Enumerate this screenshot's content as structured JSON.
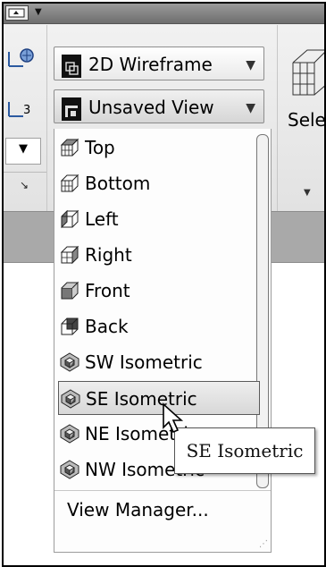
{
  "view_style": {
    "current": "2D Wireframe",
    "icon": "visual-style-icon"
  },
  "view": {
    "current": "Unsaved View",
    "icon": "view-icon",
    "items": [
      {
        "label": "Top",
        "icon": "view-top-icon"
      },
      {
        "label": "Bottom",
        "icon": "view-bottom-icon"
      },
      {
        "label": "Left",
        "icon": "view-left-icon"
      },
      {
        "label": "Right",
        "icon": "view-right-icon"
      },
      {
        "label": "Front",
        "icon": "view-front-icon"
      },
      {
        "label": "Back",
        "icon": "view-back-icon"
      },
      {
        "label": "SW Isometric",
        "icon": "isometric-icon"
      },
      {
        "label": "SE Isometric",
        "icon": "isometric-icon"
      },
      {
        "label": "NE Isometric",
        "icon": "isometric-icon"
      },
      {
        "label": "NW Isometric",
        "icon": "isometric-icon"
      }
    ],
    "selected_index": 7,
    "manager_label": "View Manager..."
  },
  "right_panel": {
    "label": "Selec"
  },
  "tooltip": {
    "text": "SE Isometric"
  },
  "left_buttons": {
    "label_3": "3"
  }
}
